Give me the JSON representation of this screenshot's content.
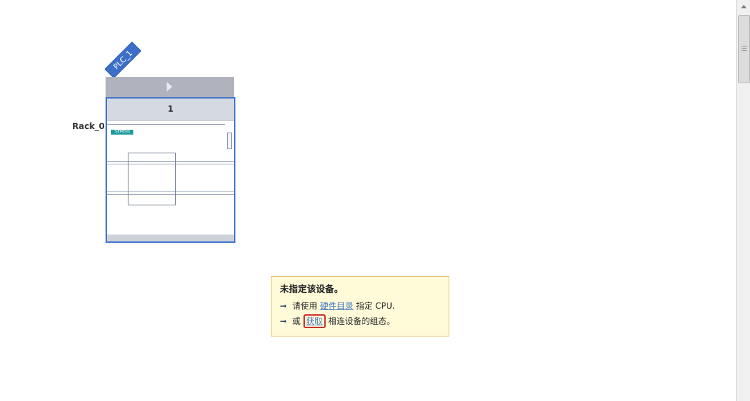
{
  "device": {
    "plc_name": "PLC_1",
    "rack_name": "Rack_0",
    "slot_number": "1",
    "logo_text": "SIEMENS"
  },
  "info": {
    "title": "未指定该设备。",
    "line1_prefix": "请使用",
    "line1_link": "硬件目录",
    "line1_suffix": "指定 CPU.",
    "line2_prefix": "或",
    "line2_link": "获取",
    "line2_suffix": "相连设备的组态。"
  },
  "colors": {
    "accent_blue": "#3f73cc",
    "tooltip_bg": "#fffbd9",
    "highlight_red": "#d02d2d"
  }
}
